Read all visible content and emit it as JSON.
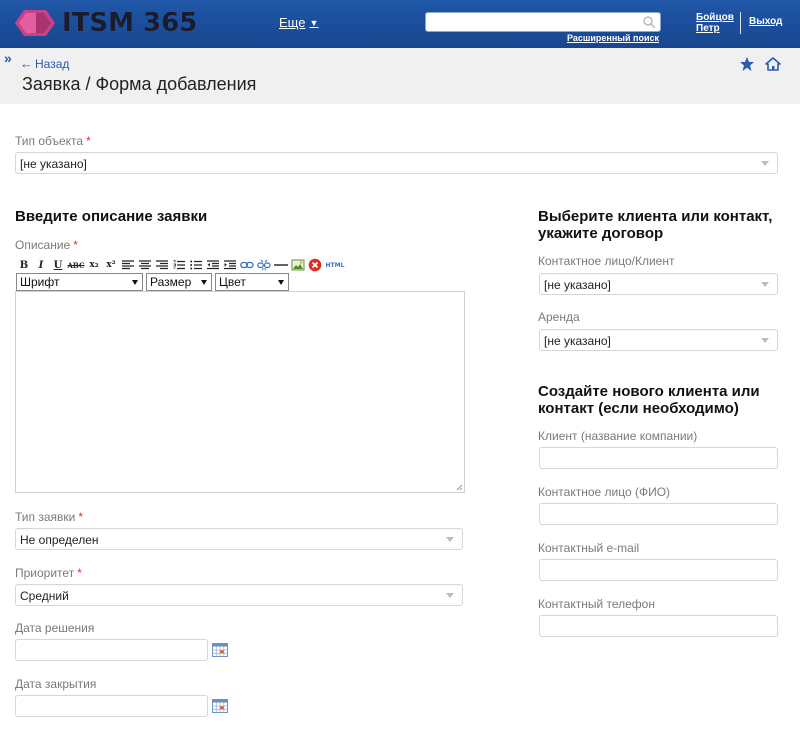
{
  "header": {
    "logo_text": "ITSM 365",
    "more_label": "Еще",
    "search_placeholder": "",
    "advanced_search": "Расширенный поиск",
    "user_line1": "Бойцов",
    "user_line2": "Петр",
    "logout": "Выход"
  },
  "subheader": {
    "expand": "»",
    "back": "Назад",
    "title": "Заявка / Форма добавления"
  },
  "form": {
    "object_type": {
      "label": "Тип объекта",
      "required": "*",
      "value": "[не указано]"
    },
    "left": {
      "section_title": "Введите описание заявки",
      "description": {
        "label": "Описание",
        "required": "*"
      },
      "editor": {
        "font_select": "Шрифт",
        "size_select": "Размер",
        "color_select": "Цвет",
        "buttons": {
          "bold": "B",
          "italic": "I",
          "underline": "U",
          "strike": "ABC",
          "subscript": "x₂",
          "superscript": "x²",
          "html": "HTML"
        }
      },
      "request_type": {
        "label": "Тип заявки",
        "required": "*",
        "value": "Не определен"
      },
      "priority": {
        "label": "Приоритет",
        "required": "*",
        "value": "Средний"
      },
      "resolution_date": {
        "label": "Дата решения"
      },
      "closing_date": {
        "label": "Дата закрытия"
      }
    },
    "right": {
      "section1_title_line1": "Выберите клиента или контакт,",
      "section1_title_line2": "укажите договор",
      "contact_client": {
        "label": "Контактное лицо/Клиент",
        "value": "[не указано]"
      },
      "lease": {
        "label": "Аренда",
        "value": "[не указано]"
      },
      "section2_title_line1": "Создайте нового клиента или",
      "section2_title_line2": "контакт (если необходимо)",
      "client_company": {
        "label": "Клиент (название компании)"
      },
      "contact_person": {
        "label": "Контактное лицо (ФИО)"
      },
      "contact_email": {
        "label": "Контактный e-mail"
      },
      "contact_phone": {
        "label": "Контактный телефон"
      }
    }
  },
  "colors": {
    "header_bg": "#1b4f9c",
    "link_blue": "#2a5bb0",
    "logo_pink": "#d9468f",
    "required_red": "#dd3333"
  },
  "icons": [
    "hexagon-logo-icon",
    "search-icon",
    "star-icon",
    "home-icon",
    "calendar-icon",
    "chevron-down-icon",
    "back-arrow-icon"
  ]
}
